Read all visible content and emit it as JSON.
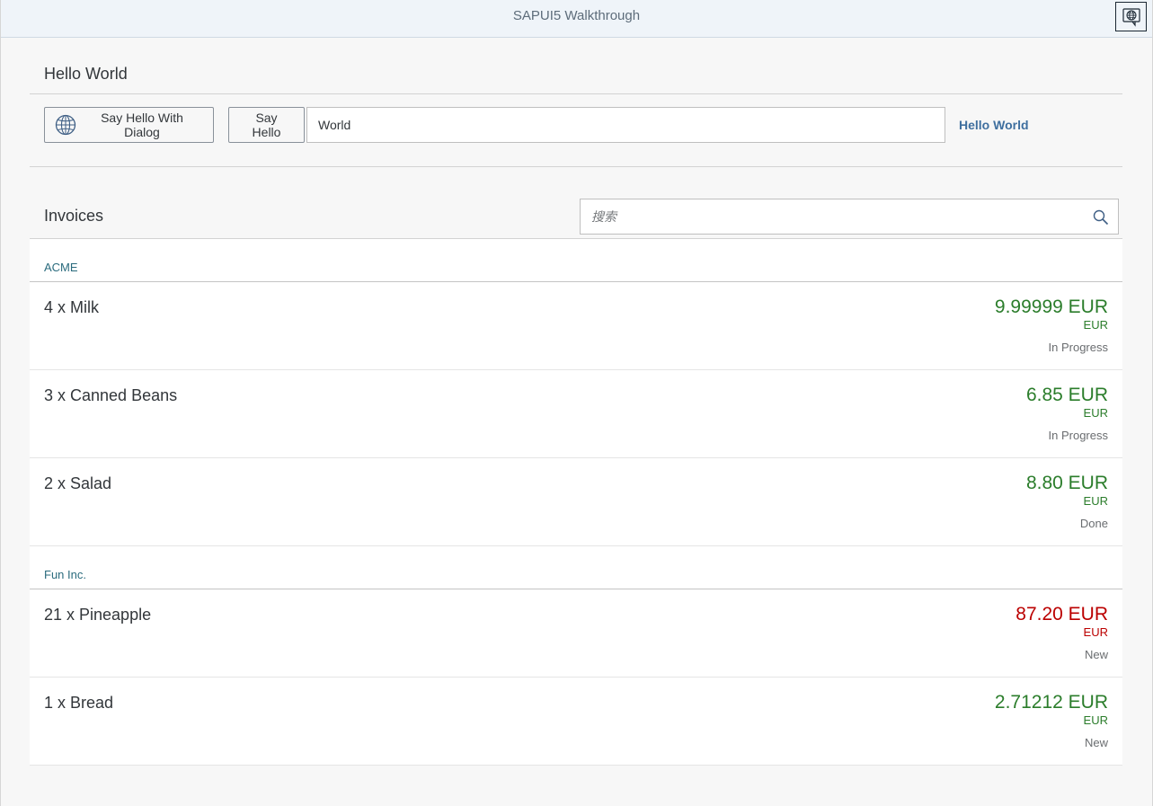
{
  "shell": {
    "title": "SAPUI5 Walkthrough",
    "button_icon": "globe-speech-icon"
  },
  "hello_panel": {
    "title": "Hello World",
    "dialog_button_label": "Say Hello With Dialog",
    "dialog_button_icon": "globe-icon",
    "hello_button_label": "Say Hello",
    "name_input_value": "World",
    "greeting_text": "Hello World"
  },
  "invoices": {
    "title": "Invoices",
    "search_placeholder": "搜索",
    "groups": [
      {
        "name": "ACME",
        "items": [
          {
            "title": "4 x Milk",
            "number": "9.99999 EUR",
            "unit": "EUR",
            "status": "In Progress",
            "state": "success"
          },
          {
            "title": "3 x Canned Beans",
            "number": "6.85 EUR",
            "unit": "EUR",
            "status": "In Progress",
            "state": "success"
          },
          {
            "title": "2 x Salad",
            "number": "8.80 EUR",
            "unit": "EUR",
            "status": "Done",
            "state": "success"
          }
        ]
      },
      {
        "name": "Fun Inc.",
        "items": [
          {
            "title": "21 x Pineapple",
            "number": "87.20 EUR",
            "unit": "EUR",
            "status": "New",
            "state": "error"
          },
          {
            "title": "1 x Bread",
            "number": "2.71212 EUR",
            "unit": "EUR",
            "status": "New",
            "state": "success"
          }
        ]
      }
    ]
  },
  "colors": {
    "success": "#2b7d2b",
    "error": "#bb0000",
    "link": "#3f6f9f",
    "group_header": "#2a6b7d",
    "shell_bg": "#eff4f9"
  }
}
